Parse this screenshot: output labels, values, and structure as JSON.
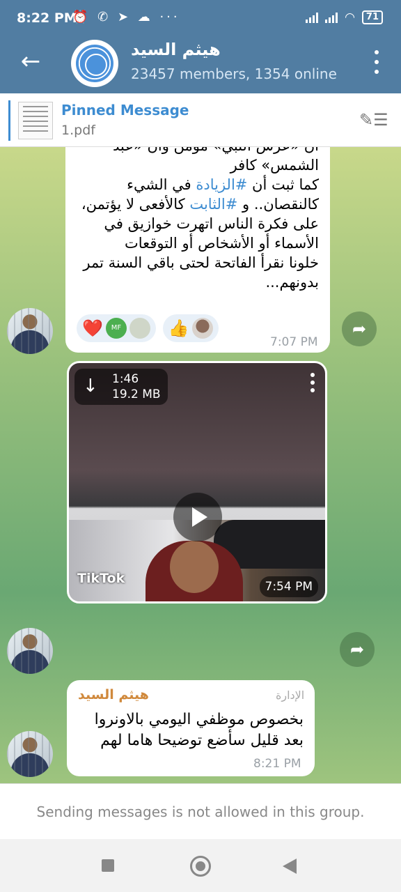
{
  "status_bar": {
    "time": "8:22 PM",
    "left_icons": "⏰ ✆ ➤ ☁  ···",
    "battery": "71"
  },
  "header": {
    "title": "هيثم السيد",
    "subtitle": "23457 members, 1354 online",
    "accent_color": "#517da2"
  },
  "pinned": {
    "title": "Pinned Message",
    "file_name": "1.pdf"
  },
  "messages": [
    {
      "lines_top": "أن «عرس النبي» مؤمن وأن «عبد",
      "line2": "الشمس» كافر",
      "line3_pre": "كما ثبت أن ",
      "hashtag1": "#الزيادة",
      "line3_post": " في الشيء",
      "line4_pre": "كالنقصان.. و ",
      "hashtag2": "#الثابت",
      "line4_post": " كالأفعى لا يؤتمن،",
      "line5": "على فكرة الناس اتهرت خوازيق في",
      "line6": "الأسماء أو الأشخاص أو التوقعات",
      "line7": "خلونا نقرأ الفاتحة لحتى باقي السنة تمر",
      "line8": "بدونهم...",
      "reaction1_emoji": "❤️",
      "reaction1_initials": "MF",
      "reaction2_emoji": "👍",
      "time": "7:07 PM"
    },
    {
      "type": "video",
      "duration": "1:46",
      "size": "19.2 MB",
      "watermark": "TikTok",
      "time": "7:54 PM"
    },
    {
      "sender": "هيثم السيد",
      "role": "الإدارة",
      "line1": "بخصوص موظفي اليومي بالاونروا",
      "line2": "بعد قليل سأضع توضيحا هاما لهم",
      "time": "8:21 PM"
    }
  ],
  "notice": "Sending messages is not allowed in this group."
}
